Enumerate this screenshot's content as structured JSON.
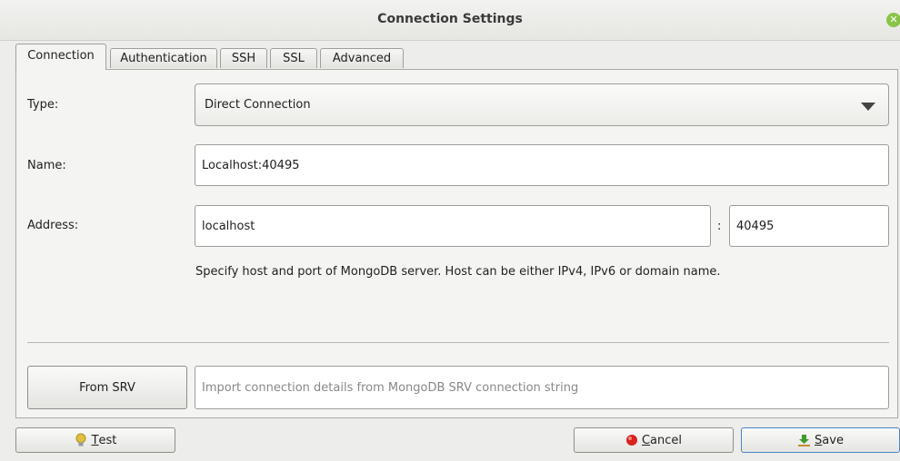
{
  "window": {
    "title": "Connection Settings"
  },
  "tabs": [
    {
      "label": "Connection",
      "active": true
    },
    {
      "label": "Authentication",
      "active": false
    },
    {
      "label": "SSH",
      "active": false
    },
    {
      "label": "SSL",
      "active": false
    },
    {
      "label": "Advanced",
      "active": false
    }
  ],
  "form": {
    "type_label": "Type:",
    "type_value": "Direct Connection",
    "name_label": "Name:",
    "name_value": "Localhost:40495",
    "address_label": "Address:",
    "host_value": "localhost",
    "port_separator": ":",
    "port_value": "40495",
    "help_text": "Specify host and port of MongoDB server. Host can be either IPv4, IPv6 or domain name."
  },
  "srv": {
    "button_label": "From SRV",
    "placeholder": "Import connection details from MongoDB SRV connection string"
  },
  "footer": {
    "test": {
      "mnemonic": "T",
      "rest": "est"
    },
    "cancel": {
      "mnemonic": "C",
      "rest": "ancel"
    },
    "save": {
      "mnemonic": "S",
      "rest": "ave"
    }
  },
  "colors": {
    "accent": "#4a86c8",
    "close": "#8bc34a",
    "cancel_icon": "#d8231f",
    "save_icon": "#3f9a2f",
    "test_icon": "#e0c040"
  }
}
